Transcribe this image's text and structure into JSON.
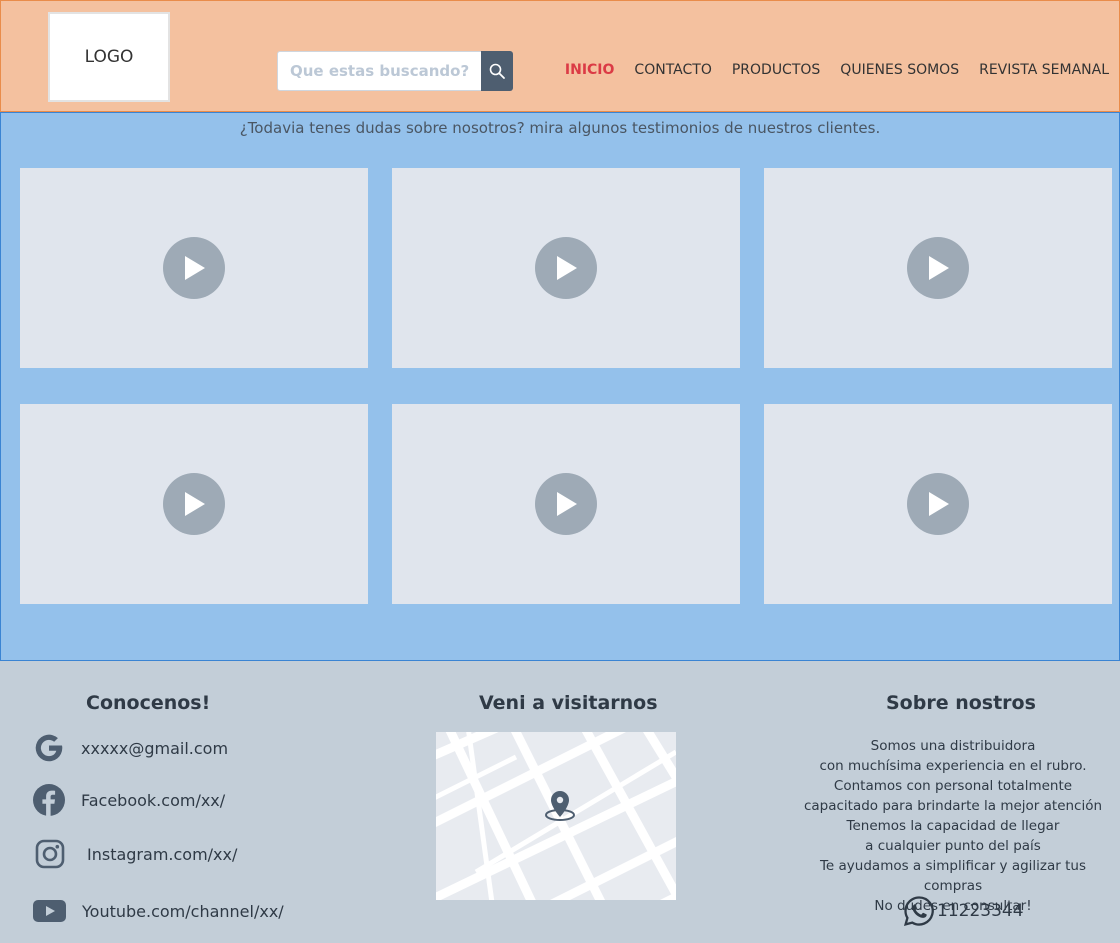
{
  "header": {
    "logo_text": "LOGO",
    "search": {
      "placeholder": "Que estas buscando?..."
    },
    "nav": [
      {
        "label": "INICIO",
        "active": true
      },
      {
        "label": "CONTACTO"
      },
      {
        "label": "PRODUCTOS"
      },
      {
        "label": "QUIENES SOMOS"
      },
      {
        "label": "REVISTA SEMANAL"
      }
    ]
  },
  "testimonials": {
    "intro": "¿Todavia tenes dudas sobre nosotros? mira algunos testimonios de nuestros clientes.",
    "videos": [
      "play-icon",
      "play-icon",
      "play-icon",
      "play-icon",
      "play-icon",
      "play-icon"
    ]
  },
  "footer": {
    "social": {
      "title": "Conocenos!",
      "items": [
        {
          "icon": "google-icon",
          "text": "xxxxx@gmail.com"
        },
        {
          "icon": "facebook-icon",
          "text": "Facebook.com/xx/"
        },
        {
          "icon": "instagram-icon",
          "text": "Instagram.com/xx/"
        },
        {
          "icon": "youtube-icon",
          "text": "Youtube.com/channel/xx/"
        }
      ]
    },
    "visit": {
      "title": "Veni a visitarnos",
      "icon": "map-pin-icon"
    },
    "about": {
      "title": "Sobre nostros",
      "lines": [
        "Somos una distribuidora",
        "con muchísima experiencia en el rubro.",
        "Contamos con personal totalmente",
        "capacitado para brindarte la mejor atención",
        "Tenemos la capacidad de llegar",
        "a cualquier punto del país",
        "Te ayudamos a simplificar y agilizar tus compras",
        "No dudes en consultar!"
      ],
      "phone": "11223344",
      "phone_icon": "whatsapp-icon"
    }
  },
  "colors": {
    "header_bg": "#f4c19f",
    "testimonials_bg": "#94c1eb",
    "footer_bg": "#c3ced8",
    "nav_active": "#db3b45"
  }
}
